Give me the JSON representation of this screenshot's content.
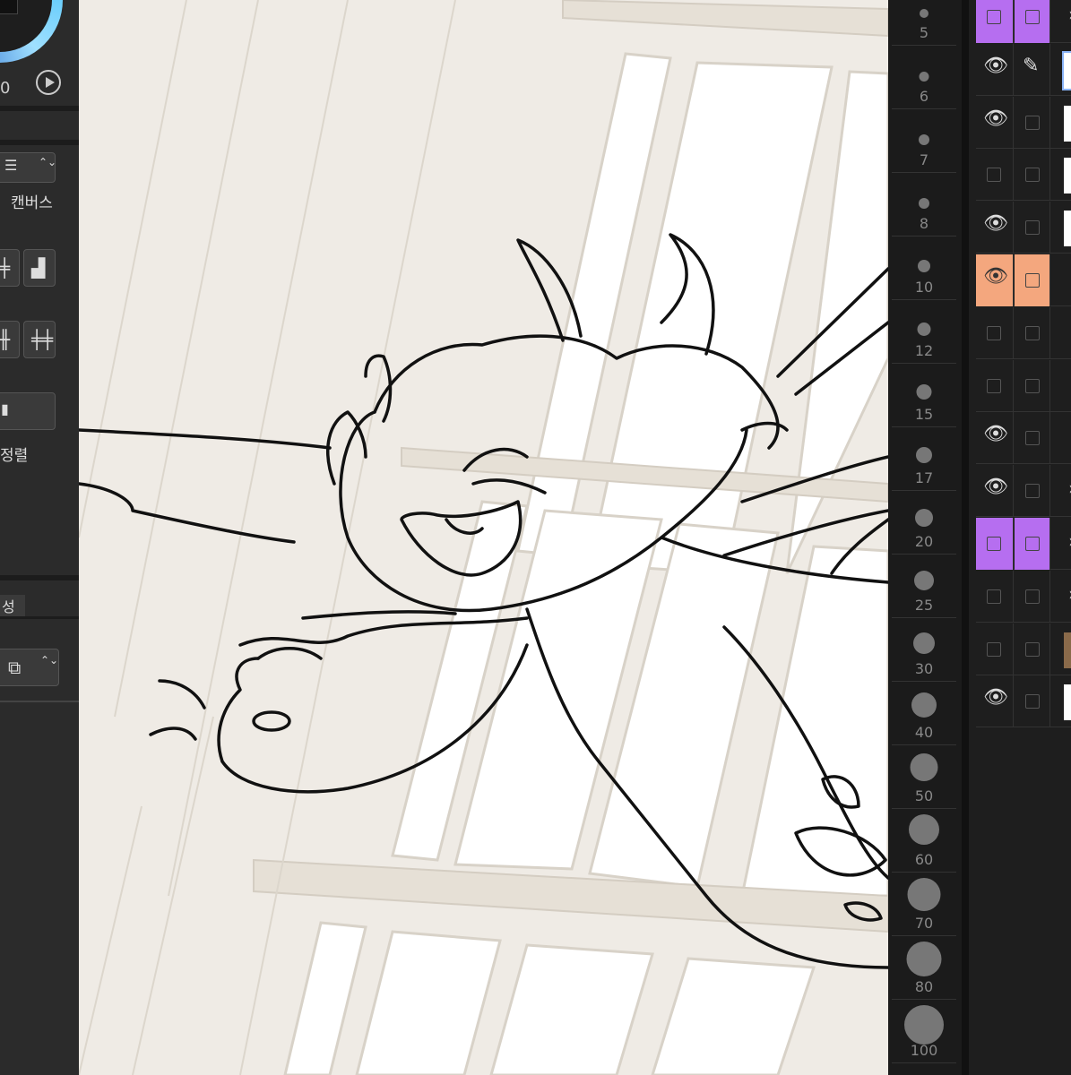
{
  "left_panel": {
    "value_text": "0",
    "canvas_label": "캔버스",
    "align_label": "정렬",
    "tab_label": "성"
  },
  "brush_sizes": [
    {
      "size": 5,
      "label": "5"
    },
    {
      "size": 6,
      "label": "6"
    },
    {
      "size": 7,
      "label": "7"
    },
    {
      "size": 8,
      "label": "8"
    },
    {
      "size": 10,
      "label": "10"
    },
    {
      "size": 12,
      "label": "12"
    },
    {
      "size": 15,
      "label": "15"
    },
    {
      "size": 17,
      "label": "17"
    },
    {
      "size": 20,
      "label": "20"
    },
    {
      "size": 25,
      "label": "25"
    },
    {
      "size": 30,
      "label": "30"
    },
    {
      "size": 40,
      "label": "40"
    },
    {
      "size": 50,
      "label": "50"
    },
    {
      "size": 60,
      "label": "60"
    },
    {
      "size": 70,
      "label": "70"
    },
    {
      "size": 80,
      "label": "80"
    },
    {
      "size": 100,
      "label": "100"
    }
  ],
  "layers": [
    {
      "visible": false,
      "color": "#b66ef0",
      "kind": "folder-collapsed"
    },
    {
      "visible": true,
      "color": null,
      "kind": "layer-pen",
      "selected": true
    },
    {
      "visible": true,
      "color": null,
      "kind": "layer"
    },
    {
      "visible": false,
      "color": null,
      "kind": "layer"
    },
    {
      "visible": true,
      "color": null,
      "kind": "layer"
    },
    {
      "visible": true,
      "color": "#f4a77e",
      "kind": "folder-expanded"
    },
    {
      "visible": false,
      "color": null,
      "kind": "sublayer"
    },
    {
      "visible": false,
      "color": null,
      "kind": "sublayer"
    },
    {
      "visible": true,
      "color": null,
      "kind": "sublayer"
    },
    {
      "visible": true,
      "color": null,
      "kind": "folder-collapsed"
    },
    {
      "visible": false,
      "color": "#b66ef0",
      "kind": "folder-collapsed"
    },
    {
      "visible": false,
      "color": null,
      "kind": "folder-collapsed"
    },
    {
      "visible": false,
      "color": null,
      "kind": "layer-image"
    },
    {
      "visible": true,
      "color": null,
      "kind": "layer-paper"
    }
  ],
  "colors": {
    "canvas_bg": "#efebe5",
    "panel_bg": "#2b2b2b",
    "purple_tag": "#b66ef0",
    "orange_tag": "#f4a77e"
  }
}
